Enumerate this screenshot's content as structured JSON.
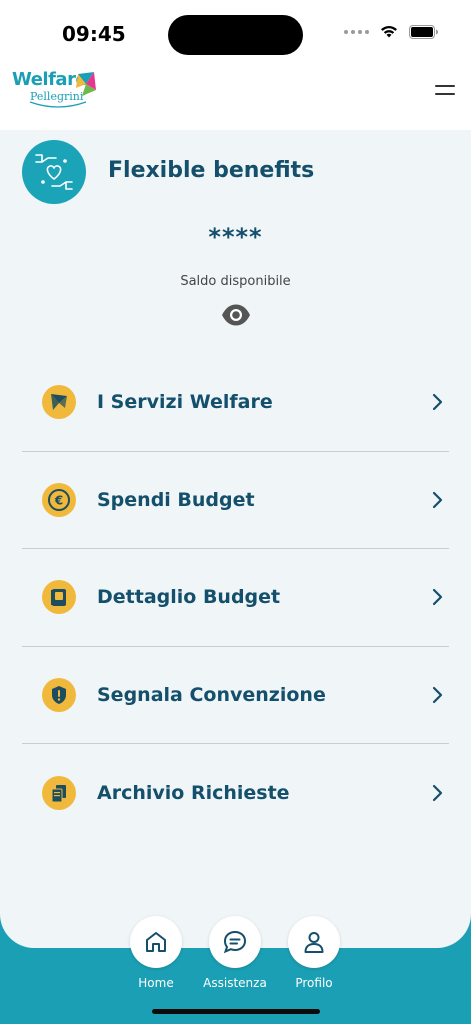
{
  "status_bar": {
    "time": "09:45"
  },
  "header": {
    "logo_primary": "Welfare",
    "logo_secondary": "Pellegrini"
  },
  "benefits": {
    "title": "Flexible benefits",
    "balance_masked": "****",
    "balance_label": "Saldo disponibile"
  },
  "menu": {
    "items": [
      {
        "label": "I Servizi Welfare",
        "icon": "kite-icon"
      },
      {
        "label": "Spendi Budget",
        "icon": "euro-coin-icon"
      },
      {
        "label": "Dettaglio Budget",
        "icon": "wallet-icon"
      },
      {
        "label": "Segnala Convenzione",
        "icon": "shield-alert-icon"
      },
      {
        "label": "Archivio Richieste",
        "icon": "documents-icon"
      }
    ]
  },
  "tabs": [
    {
      "label": "Home",
      "icon": "home-icon"
    },
    {
      "label": "Assistenza",
      "icon": "chat-icon"
    },
    {
      "label": "Profilo",
      "icon": "user-icon"
    }
  ],
  "colors": {
    "brand_teal": "#1b9fb4",
    "text_dark_teal": "#144f6b",
    "icon_yellow": "#f1b93c",
    "content_bg": "#f0f5f8"
  }
}
